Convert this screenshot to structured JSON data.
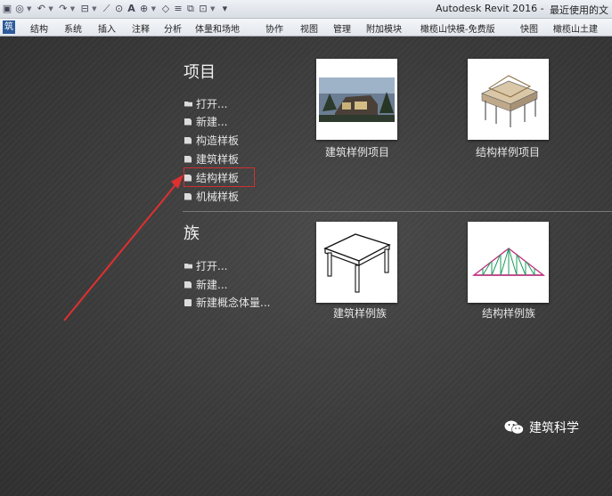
{
  "window": {
    "title": "Autodesk Revit 2016 -",
    "recent_label": "最近使用的文"
  },
  "ribbon": {
    "tabs": [
      {
        "label": "筑",
        "active": true
      },
      {
        "label": "结构"
      },
      {
        "label": "系统"
      },
      {
        "label": "插入"
      },
      {
        "label": "注释"
      },
      {
        "label": "分析"
      },
      {
        "label": "体量和场地"
      },
      {
        "label": "协作"
      },
      {
        "label": "视图"
      },
      {
        "label": "管理"
      },
      {
        "label": "附加模块"
      },
      {
        "label": "橄榄山快模-免费版"
      },
      {
        "label": "快图"
      },
      {
        "label": "橄榄山土建"
      }
    ]
  },
  "projects": {
    "heading": "项目",
    "links": [
      {
        "label": "打开...",
        "icon": "open-folder-icon"
      },
      {
        "label": "新建...",
        "icon": "new-file-icon"
      },
      {
        "label": "构造样板",
        "icon": "template-file-icon"
      },
      {
        "label": "建筑样板",
        "icon": "template-file-icon"
      },
      {
        "label": "结构样板",
        "icon": "template-file-icon"
      },
      {
        "label": "机械样板",
        "icon": "template-file-icon"
      }
    ],
    "samples": [
      {
        "label": "建筑样例项目",
        "icon": "building-render-icon"
      },
      {
        "label": "结构样例项目",
        "icon": "structure-render-icon"
      }
    ]
  },
  "families": {
    "heading": "族",
    "links": [
      {
        "label": "打开...",
        "icon": "open-folder-icon"
      },
      {
        "label": "新建...",
        "icon": "new-file-icon"
      },
      {
        "label": "新建概念体量...",
        "icon": "mass-icon"
      }
    ],
    "samples": [
      {
        "label": "建筑样例族",
        "icon": "table-icon"
      },
      {
        "label": "结构样例族",
        "icon": "truss-icon"
      }
    ]
  },
  "watermark": {
    "text": "建筑科学",
    "icon": "wechat-icon"
  },
  "colors": {
    "highlight": "#d03030",
    "arrow": "#e03030",
    "active_tab": "#2d5b9a"
  }
}
